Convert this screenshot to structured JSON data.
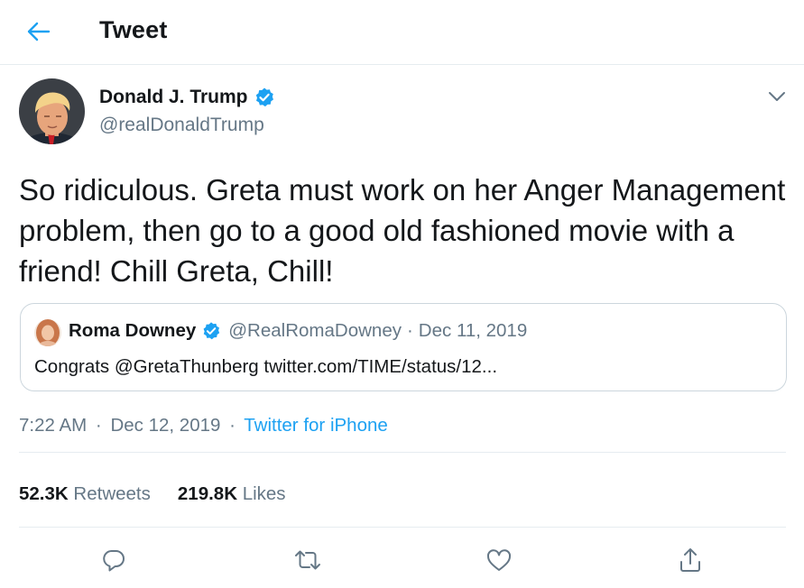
{
  "header": {
    "title": "Tweet",
    "back_icon": "arrow-left-icon"
  },
  "author": {
    "name": "Donald J. Trump",
    "handle": "@realDonaldTrump",
    "verified": true
  },
  "tweet": {
    "text": "So ridiculous. Greta must work on her Anger Management problem, then go to a good old fashioned movie with a friend! Chill Greta, Chill!"
  },
  "quoted_tweet": {
    "name": "Roma Downey",
    "handle": "@RealRomaDowney",
    "separator": "·",
    "date": "Dec 11, 2019",
    "text": "Congrats @GretaThunberg twitter.com/TIME/status/12..."
  },
  "meta": {
    "time": "7:22 AM",
    "separator": "·",
    "date": "Dec 12, 2019",
    "source": "Twitter for iPhone"
  },
  "stats": {
    "retweets_count": "52.3K",
    "retweets_label": "Retweets",
    "likes_count": "219.8K",
    "likes_label": "Likes"
  },
  "actions": [
    "reply-icon",
    "retweet-icon",
    "like-icon",
    "share-icon"
  ],
  "colors": {
    "accent": "#1da1f2",
    "secondary_text": "#657786",
    "border": "#e6ecf0",
    "quote_border": "#ccd6dd"
  }
}
